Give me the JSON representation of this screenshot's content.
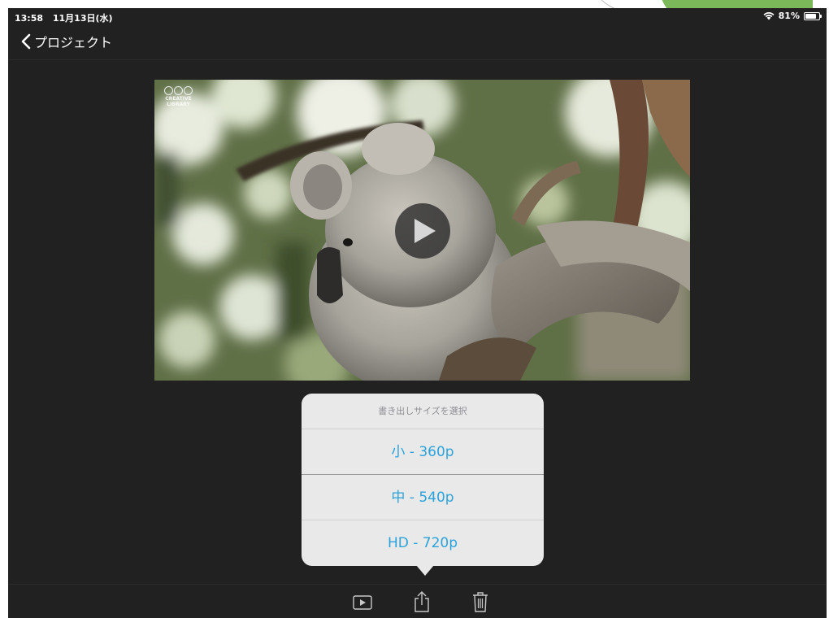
{
  "status_bar": {
    "time": "13:58",
    "date": "11月13日(水)",
    "battery_text": "81%",
    "battery_level": 0.81
  },
  "nav": {
    "back_label": "プロジェクト"
  },
  "video": {
    "watermark_line1": "CREATIVE",
    "watermark_line2": "LIBRARY"
  },
  "popover": {
    "title": "書き出しサイズを選択",
    "options": [
      {
        "label": "小 - 360p"
      },
      {
        "label": "中 - 540p"
      },
      {
        "label": "HD - 720p"
      }
    ]
  },
  "toolbar": {
    "icons": [
      "play-icon",
      "share-icon",
      "trash-icon"
    ]
  },
  "colors": {
    "background": "#212121",
    "accent": "#2aa3dc",
    "popover_bg": "#e9e9e9",
    "page_corner": "#7ab85a"
  }
}
